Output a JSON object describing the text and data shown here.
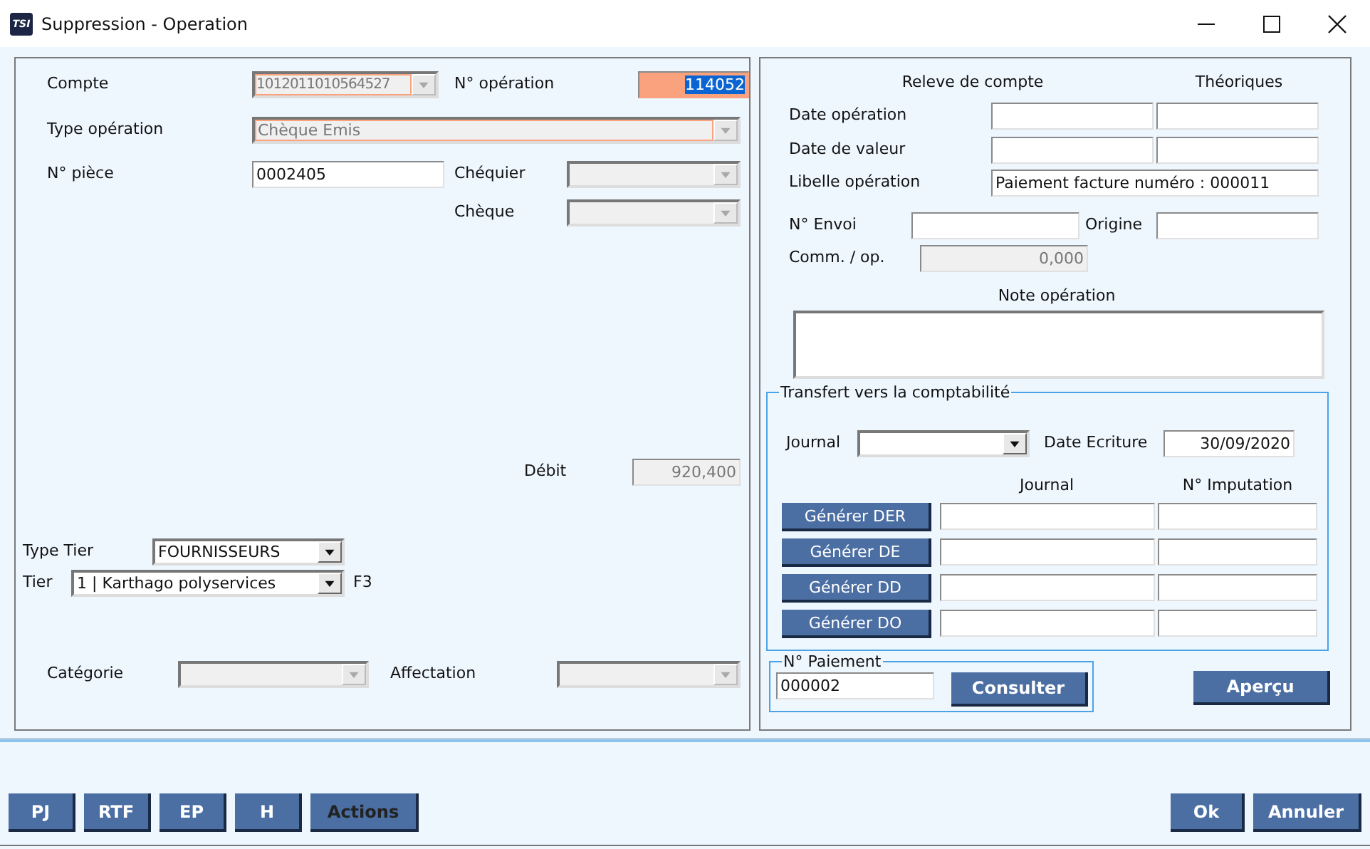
{
  "window": {
    "title": "Suppression - Operation",
    "logo": "TSI"
  },
  "operation": {
    "compte": {
      "label": "Compte",
      "value": "1012011010564527",
      "disabled": true,
      "required": true
    },
    "numero": {
      "label": "N° opération",
      "value": "114052",
      "required": true,
      "text_selected": true
    },
    "type": {
      "label": "Type opération",
      "value": "Chèque Emis",
      "disabled": true,
      "required": true
    },
    "piece": {
      "label": "N° pièce",
      "value": "0002405",
      "disabled": false
    },
    "chequier": {
      "label": "Chéquier",
      "disabled": true
    },
    "cheque": {
      "label": "Chèque",
      "disabled": true
    },
    "debit": {
      "label": "Débit",
      "value": "920,400",
      "disabled": true
    },
    "type_tier": {
      "label": "Type Tier",
      "value": "FOURNISSEURS",
      "disabled": false
    },
    "tier": {
      "label": "Tier",
      "value": "1 | Karthago polyservices",
      "disabled": false,
      "shortcut": "F3"
    },
    "categorie": {
      "label": "Catégorie",
      "disabled": true
    },
    "affectation": {
      "label": "Affectation",
      "disabled": true
    }
  },
  "releve": {
    "heading": "Releve de compte",
    "heading_2": "Théoriques",
    "date_operation": {
      "label": "Date opération"
    },
    "date_valeur": {
      "label": "Date de valeur"
    },
    "libelle": {
      "label": "Libelle opération",
      "value": "Paiement facture numéro : 000011"
    },
    "envoi": {
      "label": "N° Envoi"
    },
    "origine": {
      "label": "Origine"
    },
    "comm": {
      "label": "Comm. / op.",
      "value": "0,000",
      "disabled": true
    },
    "note": {
      "label": "Note opération"
    }
  },
  "transfert": {
    "title": "Transfert vers la comptabilité",
    "journal": {
      "label": "Journal",
      "disabled": false
    },
    "date_ecriture": {
      "label": "Date Ecriture",
      "value": "30/09/2020"
    },
    "columns": [
      "Journal",
      "N° Imputation"
    ],
    "rows": [
      {
        "button": "Générer DER"
      },
      {
        "button": "Générer DE"
      },
      {
        "button": "Générer DD"
      },
      {
        "button": "Générer DO"
      }
    ]
  },
  "paiement": {
    "title": "N° Paiement",
    "value": "000002",
    "button": "Consulter"
  },
  "apercu_button": "Aperçu",
  "footer": {
    "left_buttons": [
      {
        "label": "PJ",
        "disabled": false
      },
      {
        "label": "RTF",
        "disabled": false
      },
      {
        "label": "EP",
        "disabled": false
      },
      {
        "label": "H",
        "disabled": false
      },
      {
        "label": "Actions",
        "disabled": true
      }
    ],
    "right_buttons": [
      {
        "label": "Ok",
        "disabled": false
      },
      {
        "label": "Annuler",
        "disabled": false
      }
    ]
  }
}
